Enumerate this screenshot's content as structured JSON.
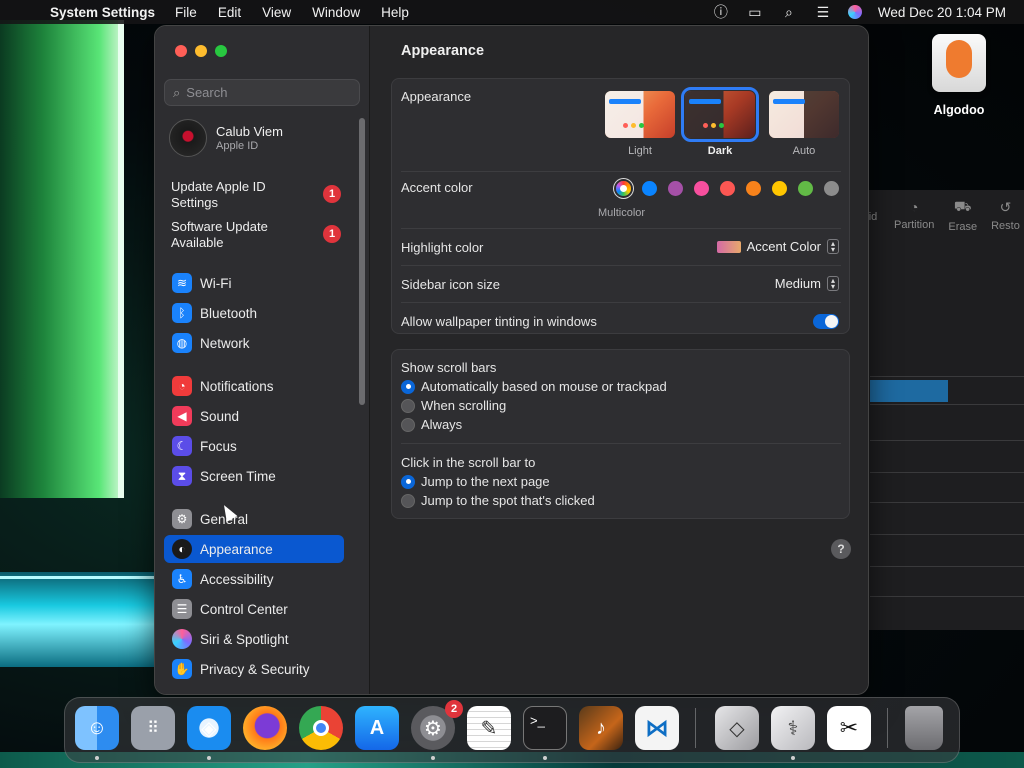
{
  "menubar": {
    "app_name": "System Settings",
    "items": [
      "File",
      "Edit",
      "View",
      "Window",
      "Help"
    ],
    "datetime": "Wed Dec 20  1:04 PM"
  },
  "desktop": {
    "icon_label": "Algodoo"
  },
  "background_window": {
    "toolbar": [
      "id",
      "Partition",
      "Erase",
      "Resto"
    ]
  },
  "window": {
    "search_placeholder": "Search",
    "profile": {
      "name": "Calub Viem",
      "sub": "Apple ID"
    },
    "alerts": [
      {
        "label": "Update Apple ID Settings",
        "badge": "1"
      },
      {
        "label": "Software Update Available",
        "badge": "1"
      }
    ],
    "sidebar": [
      {
        "label": "Wi-Fi",
        "icon": "wifi-icon",
        "color": "#1a82fb"
      },
      {
        "label": "Bluetooth",
        "icon": "bluetooth-icon",
        "color": "#1a82fb"
      },
      {
        "label": "Network",
        "icon": "globe-icon",
        "color": "#1a82fb"
      },
      {
        "label": "Notifications",
        "icon": "bell-icon",
        "color": "#f03b3b"
      },
      {
        "label": "Sound",
        "icon": "speaker-icon",
        "color": "#f03b5a"
      },
      {
        "label": "Focus",
        "icon": "moon-icon",
        "color": "#5b4de8"
      },
      {
        "label": "Screen Time",
        "icon": "hourglass-icon",
        "color": "#5b4de8"
      },
      {
        "label": "General",
        "icon": "gear-icon",
        "color": "#8e8e93"
      },
      {
        "label": "Appearance",
        "icon": "appearance-icon",
        "color": "#1a1a1a"
      },
      {
        "label": "Accessibility",
        "icon": "accessibility-icon",
        "color": "#1a82fb"
      },
      {
        "label": "Control Center",
        "icon": "control-center-icon",
        "color": "#8e8e93"
      },
      {
        "label": "Siri & Spotlight",
        "icon": "siri-icon",
        "color": "#b04ad8"
      },
      {
        "label": "Privacy & Security",
        "icon": "hand-icon",
        "color": "#1a82fb"
      }
    ],
    "selected_item": "Appearance",
    "main": {
      "title": "Appearance",
      "appearance_label": "Appearance",
      "appearance_options": [
        "Light",
        "Dark",
        "Auto"
      ],
      "appearance_selected": "Dark",
      "accent_label": "Accent color",
      "accent_multicolor_label": "Multicolor",
      "accent_colors": [
        "multicolor",
        "#0a84ff",
        "#a550a7",
        "#f74f9e",
        "#fc5753",
        "#f7821b",
        "#ffc600",
        "#62ba46",
        "#8c8c8c"
      ],
      "highlight_label": "Highlight color",
      "highlight_value": "Accent Color",
      "sidebar_icon_label": "Sidebar icon size",
      "sidebar_icon_value": "Medium",
      "tinting_label": "Allow wallpaper tinting in windows",
      "tinting_on": true,
      "scrollbars_label": "Show scroll bars",
      "scrollbar_options": [
        "Automatically based on mouse or trackpad",
        "When scrolling",
        "Always"
      ],
      "scrollbar_selected": 0,
      "click_label": "Click in the scroll bar to",
      "click_options": [
        "Jump to the next page",
        "Jump to the spot that's clicked"
      ],
      "click_selected": 0,
      "help": "?"
    }
  },
  "dock": {
    "apps": [
      {
        "name": "finder",
        "color": "#3d9bf0",
        "glyph": "☺",
        "running": true
      },
      {
        "name": "launchpad",
        "color": "#9aa0aa",
        "glyph": "⠿",
        "running": false
      },
      {
        "name": "safari",
        "color": "#1a8cf0",
        "glyph": "◈",
        "running": true
      },
      {
        "name": "firefox",
        "color": "#ff7a18",
        "glyph": "◉",
        "running": false
      },
      {
        "name": "chrome",
        "color": "#e8e8e8",
        "glyph": "◎",
        "running": false
      },
      {
        "name": "app-store",
        "color": "#1a8cf0",
        "glyph": "A",
        "running": false
      },
      {
        "name": "system-settings",
        "color": "#6f6f73",
        "glyph": "⚙",
        "running": true,
        "badge": "2"
      },
      {
        "name": "textedit",
        "color": "#f2f2f2",
        "glyph": "✎",
        "running": false
      },
      {
        "name": "terminal",
        "color": "#1d1d1f",
        "glyph": ">_",
        "running": true
      },
      {
        "name": "garageband",
        "color": "#c5651a",
        "glyph": "♪",
        "running": false
      },
      {
        "name": "vscode",
        "color": "#f4f4f4",
        "glyph": "◀",
        "running": false
      },
      {
        "name": "boot-camp-assistant",
        "color": "#c9c9cc",
        "glyph": "◇",
        "running": false
      },
      {
        "name": "disk-utility",
        "color": "#d6d6d9",
        "glyph": "⚕",
        "running": true
      },
      {
        "name": "capcut",
        "color": "#ffffff",
        "glyph": "✂",
        "running": false
      },
      {
        "name": "trash",
        "color": "#8a8a8e",
        "glyph": "🗑",
        "running": false
      }
    ]
  }
}
